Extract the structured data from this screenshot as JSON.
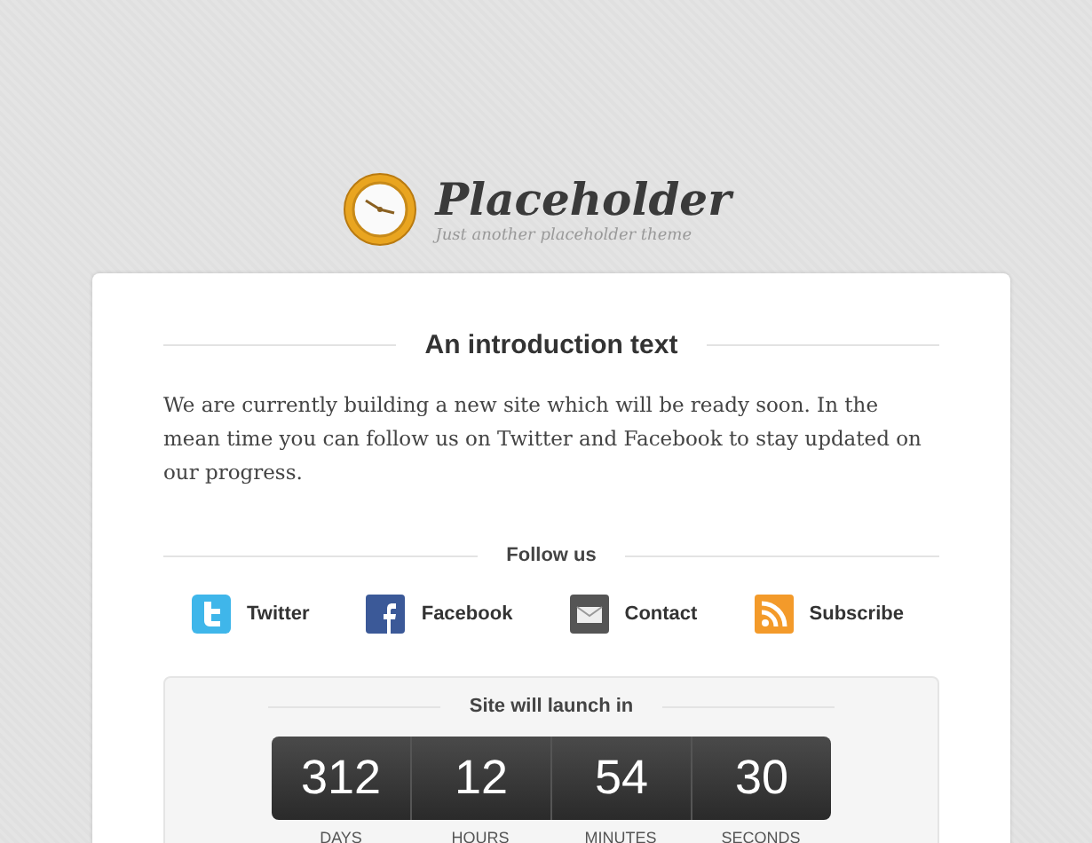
{
  "header": {
    "title": "Placeholder",
    "tagline": "Just another placeholder theme"
  },
  "intro": {
    "heading": "An introduction text",
    "text": "We are currently building a new site which will be ready soon. In the mean time you can follow us on Twitter and Facebook to stay updated on our progress."
  },
  "follow": {
    "heading": "Follow us",
    "links": [
      {
        "kind": "twitter",
        "label": "Twitter"
      },
      {
        "kind": "facebook",
        "label": "Facebook"
      },
      {
        "kind": "mail",
        "label": "Contact"
      },
      {
        "kind": "rss",
        "label": "Subscribe"
      }
    ]
  },
  "countdown": {
    "heading": "Site will launch in",
    "units": [
      {
        "value": "312",
        "label": "DAYS"
      },
      {
        "value": "12",
        "label": "HOURS"
      },
      {
        "value": "54",
        "label": "MINUTES"
      },
      {
        "value": "30",
        "label": "SECONDS"
      }
    ]
  }
}
